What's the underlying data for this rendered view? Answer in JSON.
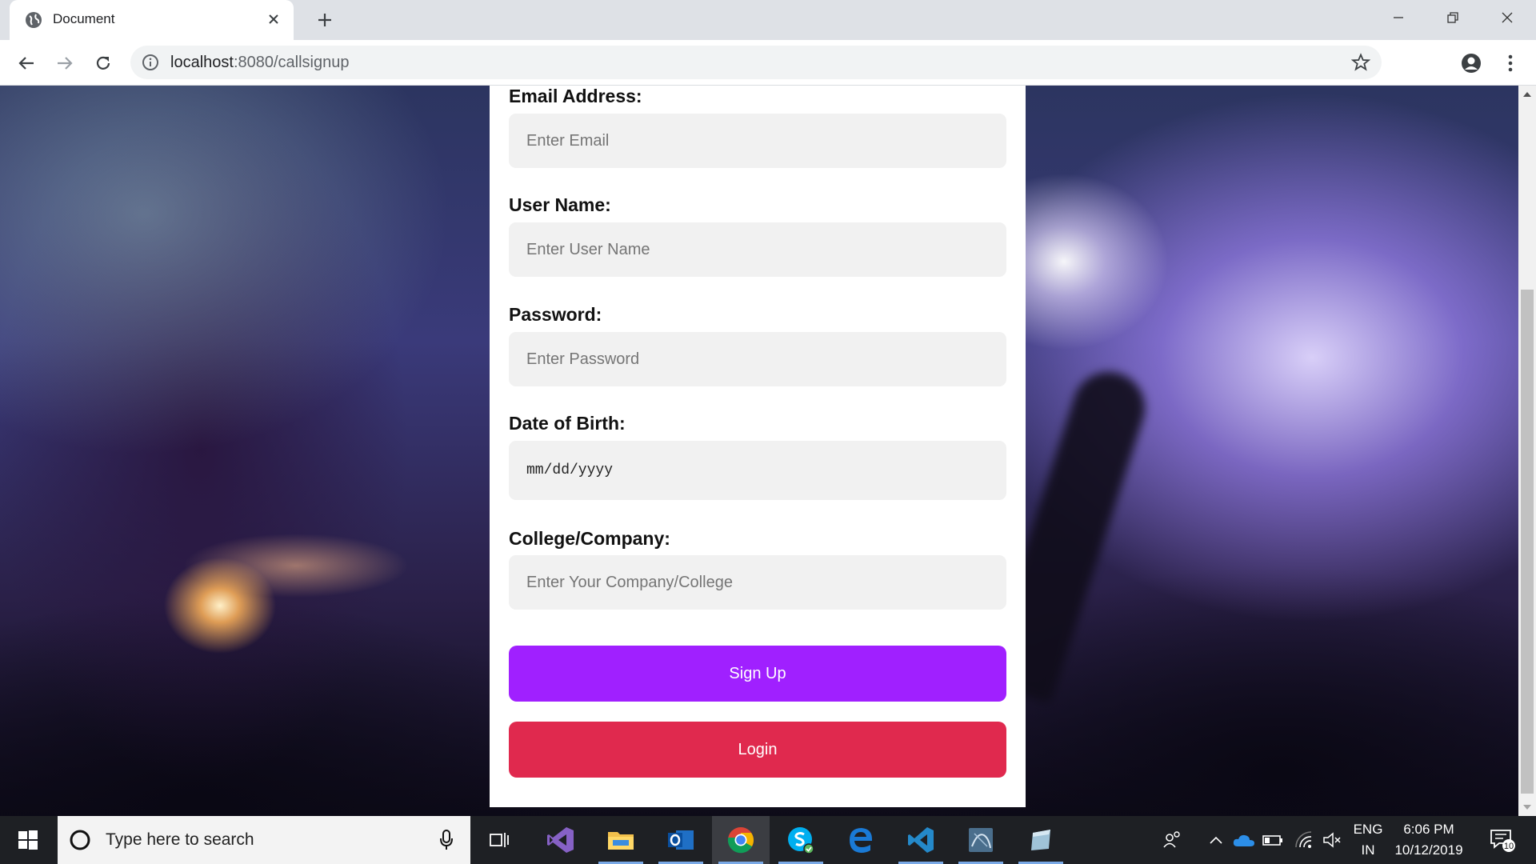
{
  "browser": {
    "tab_title": "Document",
    "url_host": "localhost",
    "url_path": ":8080/callsignup"
  },
  "form": {
    "email": {
      "label": "Email Address:",
      "placeholder": "Enter Email"
    },
    "username": {
      "label": "User Name:",
      "placeholder": "Enter User Name"
    },
    "password": {
      "label": "Password:",
      "placeholder": "Enter Password"
    },
    "dob": {
      "label": "Date of Birth:",
      "value": "mm/dd/yyyy"
    },
    "company": {
      "label": "College/Company:",
      "placeholder": "Enter Your Company/College"
    },
    "signup_label": "Sign Up",
    "login_label": "Login"
  },
  "colors": {
    "signup": "#a020ff",
    "login": "#e0294e"
  },
  "taskbar": {
    "search_placeholder": "Type here to search",
    "apps": [
      "visual-studio-icon",
      "file-explorer-icon",
      "outlook-icon",
      "chrome-icon",
      "skype-icon",
      "edge-icon",
      "vscode-icon",
      "mysql-workbench-icon",
      "generic-app-icon"
    ],
    "active_app": "chrome-icon",
    "language_line1": "ENG",
    "language_line2": "IN",
    "time": "6:06 PM",
    "date": "10/12/2019",
    "notification_count": "10"
  }
}
